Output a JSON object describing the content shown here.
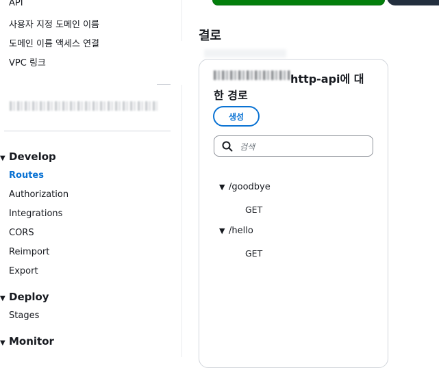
{
  "sidebar": {
    "top_links": [
      "API",
      "사용자 지정 도메인 이름",
      "도메인 이름 액세스 연결",
      "VPC 링크"
    ],
    "sections": [
      {
        "title": "Develop",
        "items": [
          "Routes",
          "Authorization",
          "Integrations",
          "CORS",
          "Reimport",
          "Export"
        ],
        "active": "Routes"
      },
      {
        "title": "Deploy",
        "items": [
          "Stages"
        ]
      },
      {
        "title": "Monitor",
        "items": []
      }
    ]
  },
  "main": {
    "page_title": "결로",
    "panel": {
      "title_line1": "http-api에 대",
      "title_line2": "한 경로",
      "create_label": "생성",
      "search_placeholder": "검색",
      "routes": [
        {
          "path": "/goodbye",
          "methods": [
            "GET"
          ]
        },
        {
          "path": "/hello",
          "methods": [
            "GET"
          ]
        }
      ]
    }
  },
  "colors": {
    "accent": "#0972d3",
    "flash_success": "#037f0c",
    "header_dark": "#232f3e"
  }
}
